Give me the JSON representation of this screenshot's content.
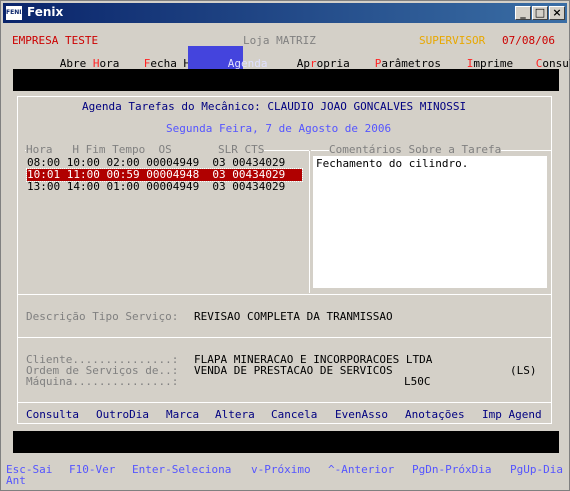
{
  "window": {
    "title": "Fenix",
    "logo_text": "FENIX"
  },
  "header": {
    "company": "EMPRESA TESTE",
    "store": "Loja MATRIZ",
    "user": "SUPERVISOR",
    "date": "07/08/06"
  },
  "menu": [
    {
      "label": "Abre Hora",
      "selected": false
    },
    {
      "label": "Fecha Hora",
      "selected": false
    },
    {
      "label": "Agenda",
      "selected": true
    },
    {
      "label": "Apropria",
      "selected": false
    },
    {
      "label": "Parâmetros",
      "selected": false
    },
    {
      "label": "Imprime",
      "selected": false
    },
    {
      "label": "Consulta",
      "selected": false
    }
  ],
  "agenda": {
    "heading": "Agenda Tarefas do Mecânico: CLAUDIO JOAO GONCALVES MINOSSI",
    "date_line": "Segunda Feira, 7 de Agosto de 2006",
    "list_header": "Hora   H Fim Tempo  OS       SLR CTS",
    "comments_header": "Comentários Sobre a Tarefa",
    "rows": [
      {
        "text": "08:00 10:00 02:00 00004949  03 00434029",
        "selected": false
      },
      {
        "text": "10:01 11:00 00:59 00004948  03 00434029",
        "selected": true
      },
      {
        "text": "13:00 14:00 01:00 00004949  03 00434029",
        "selected": false
      }
    ],
    "comment_text": "Fechamento do cilindro."
  },
  "service": {
    "label": "Descrição Tipo Serviço:",
    "value": "REVISAO COMPLETA DA TRANMISSAO"
  },
  "details": {
    "client_label": "Cliente...............:",
    "client_value": "FLAPA MINERACAO E INCORPORACOES LTDA",
    "order_label": "Ordem de Serviços de..:",
    "order_value": "VENDA DE PRESTACAO DE SERVICOS",
    "order_code": "(LS)",
    "machine_label": "Máquina...............:",
    "machine_value": "L50C"
  },
  "actions": [
    "Consulta",
    "OutroDia",
    "Marca",
    "Altera",
    "Cancela",
    "EvenAsso",
    "Anotações",
    "Imp Agend"
  ],
  "footer": {
    "keys": [
      "Esc-Sai",
      "F10-Ver",
      "Enter-Seleciona",
      "v-Próximo",
      "^-Anterior",
      "PgDn-PróxDia",
      "PgUp-Dia"
    ],
    "wrap": "Ant"
  },
  "colors": {
    "title_bar": "#0a246a",
    "selected_row": "#b00000",
    "menu_selected": "#4444dd",
    "text_blue": "#000080"
  }
}
